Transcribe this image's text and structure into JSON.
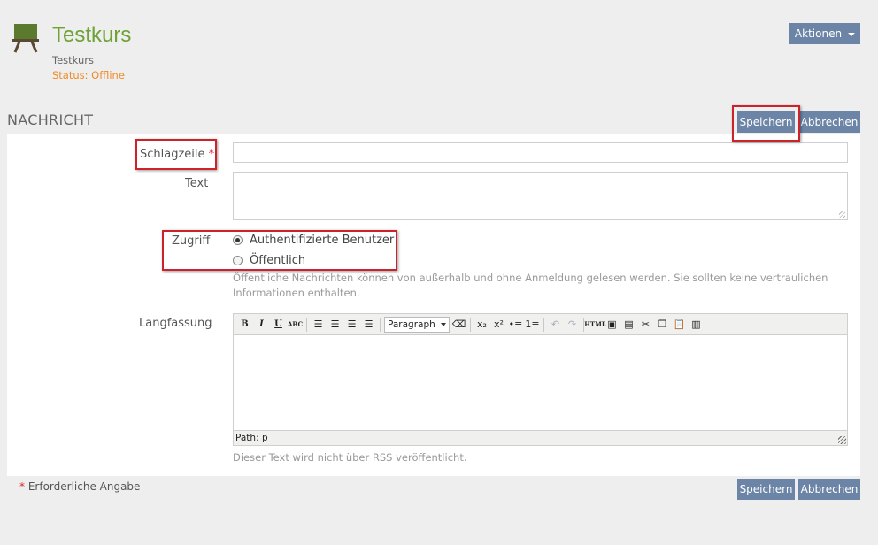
{
  "header": {
    "course_title": "Testkurs",
    "course_subtitle": "Testkurs",
    "status": "Status: Offline",
    "actions_label": "Aktionen"
  },
  "section": {
    "title": "NACHRICHT",
    "save_label": "Speichern",
    "cancel_label": "Abbrechen"
  },
  "form": {
    "headline_label": "Schlagzeile",
    "required_mark": "*",
    "text_label": "Text",
    "access_label": "Zugriff",
    "access_options": [
      {
        "label": "Authentifizierte Benutzer",
        "checked": true
      },
      {
        "label": "Öffentlich",
        "checked": false
      }
    ],
    "access_hint": "Öffentliche Nachrichten können von außerhalb und ohne Anmeldung gelesen werden. Sie sollten keine vertraulichen Informationen enthalten.",
    "long_label": "Langfassung",
    "editor": {
      "format_value": "Paragraph",
      "path_text": "Path: p",
      "toolbar": {
        "bold": "B",
        "italic": "I",
        "underline": "U",
        "strike": "ABC",
        "html": "HTML"
      }
    },
    "long_hint": "Dieser Text wird nicht über RSS veröffentlicht."
  },
  "footer": {
    "required_note": "Erforderliche Angabe",
    "save_label": "Speichern",
    "cancel_label": "Abbrechen"
  },
  "colors": {
    "accent_green": "#6fa135",
    "status_orange": "#f08a24",
    "button_blue": "#6c85a7",
    "highlight_red": "#cc2229"
  }
}
